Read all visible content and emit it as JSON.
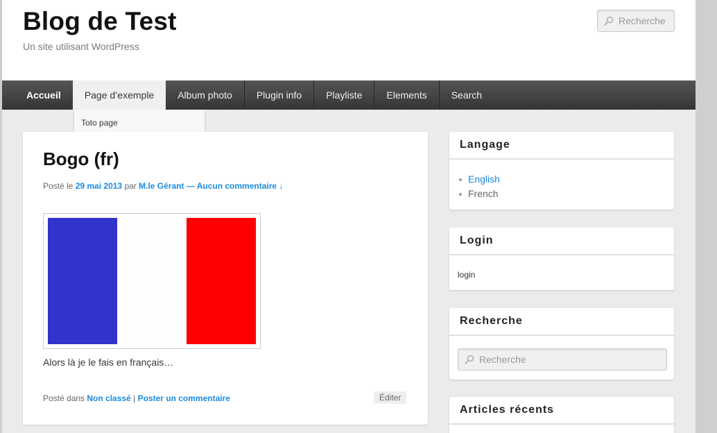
{
  "site": {
    "title": "Blog de Test",
    "description": "Un site utilisant WordPress"
  },
  "header_search": {
    "placeholder": "Recherche",
    "icon": "search-icon"
  },
  "nav": {
    "items": [
      {
        "label": "Accueil"
      },
      {
        "label": "Page d’exemple"
      },
      {
        "label": "Album photo"
      },
      {
        "label": "Plugin info"
      },
      {
        "label": "Playliste"
      },
      {
        "label": "Elements"
      },
      {
        "label": "Search"
      }
    ],
    "submenu": {
      "item": "Toto page"
    }
  },
  "post": {
    "title": "Bogo (fr)",
    "meta": {
      "posted_prefix": "Posté le",
      "date": "29 mai 2013",
      "by": "par",
      "author": "M.le Gérant",
      "comments": "— Aucun commentaire ↓"
    },
    "image_alt": "French flag",
    "flag_colors": [
      "#3232cc",
      "#fdfdfd",
      "#ff0000"
    ],
    "body": "Alors là je le fais en français…",
    "footer": {
      "prefix": "Posté dans",
      "category": "Non classé",
      "separator": "|",
      "comment_link": "Poster un commentaire"
    },
    "edit_label": "Éditer"
  },
  "sidebar": {
    "language": {
      "title": "Langage",
      "items": [
        "English",
        "French"
      ]
    },
    "login": {
      "title": "Login",
      "link": "login"
    },
    "search": {
      "title": "Recherche",
      "placeholder": "Recherche"
    },
    "recent": {
      "title": "Articles récents"
    }
  },
  "colors": {
    "link": "#1b8be0",
    "nav_bg": "#3d3d3d"
  }
}
